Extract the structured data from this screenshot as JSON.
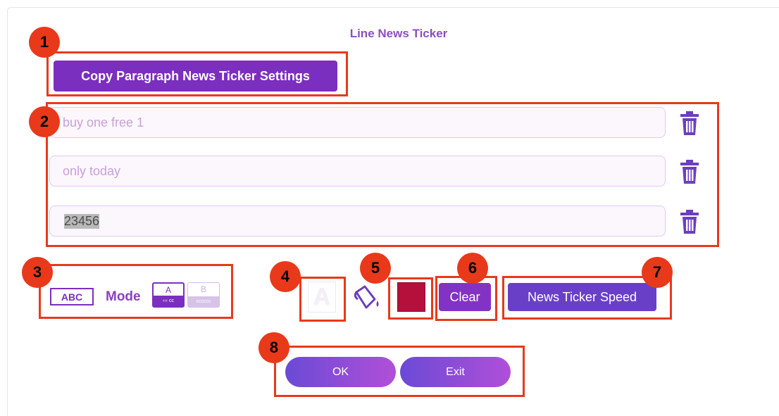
{
  "dialog": {
    "title": "Line News Ticker"
  },
  "copy_button": {
    "label": "Copy Paragraph News Ticker Settings"
  },
  "lines": [
    {
      "value": "buy one free 1"
    },
    {
      "value": "only today"
    },
    {
      "value": "23456"
    }
  ],
  "style": {
    "abc_label": "ABC",
    "mode_label": "Mode",
    "mode_a": {
      "letter": "A",
      "preview": "‹‹‹ cc"
    },
    "mode_b": {
      "letter": "B",
      "preview": "cccccc"
    },
    "text_color_glyph": "A",
    "background_color": "#b5103b",
    "clear_label": "Clear",
    "speed_label": "News Ticker Speed"
  },
  "actions": {
    "ok_label": "OK",
    "exit_label": "Exit"
  },
  "annotations": [
    "1",
    "2",
    "3",
    "4",
    "5",
    "6",
    "7",
    "8"
  ],
  "colors": {
    "accent": "#7b2fbe",
    "annotation": "#e8391b"
  },
  "icons": {
    "delete": "trash-icon",
    "fill": "paint-bucket-icon"
  }
}
